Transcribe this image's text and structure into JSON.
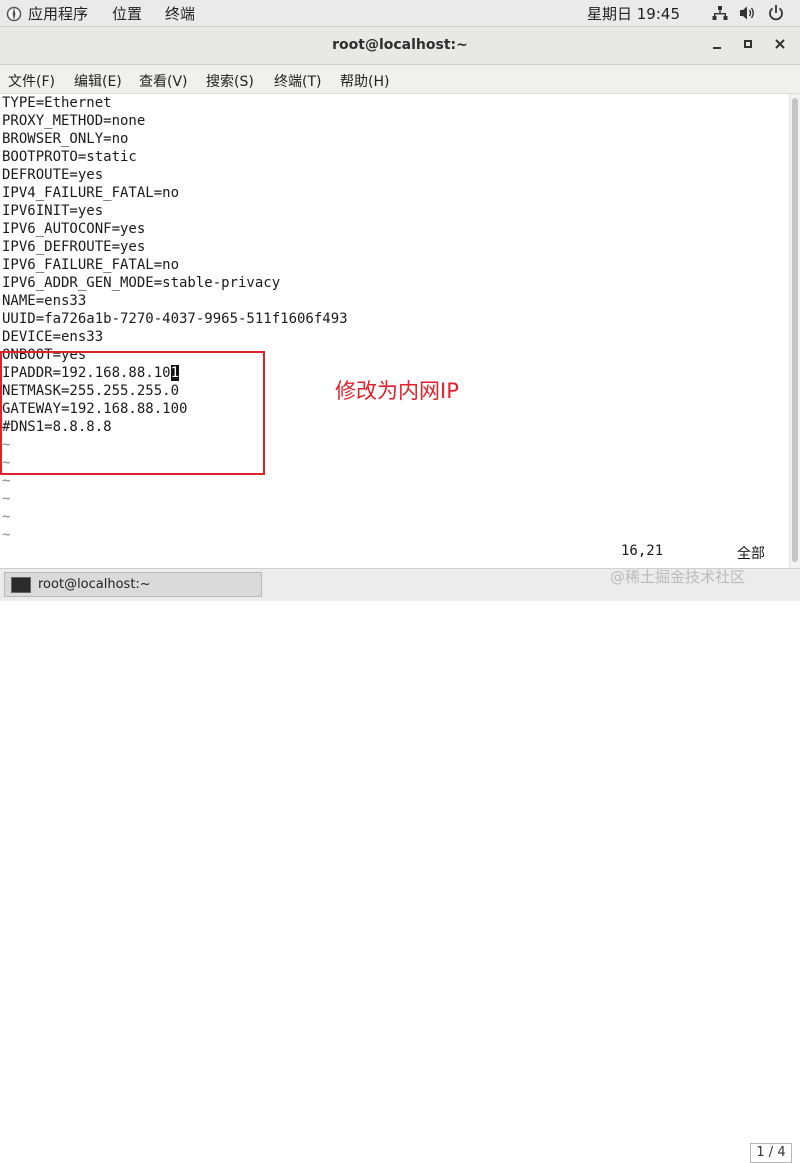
{
  "topbar": {
    "applications": "应用程序",
    "places": "位置",
    "terminal": "终端",
    "clock": "星期日 19:45",
    "icons": [
      "network-icon",
      "volume-icon",
      "power-icon"
    ]
  },
  "window": {
    "title": "root@localhost:~",
    "buttons": [
      "minimize",
      "maximize",
      "close"
    ]
  },
  "menu": {
    "file": "文件(F)",
    "edit": "编辑(E)",
    "view": "查看(V)",
    "search": "搜索(S)",
    "terminal": "终端(T)",
    "help": "帮助(H)"
  },
  "lines": [
    "TYPE=Ethernet",
    "PROXY_METHOD=none",
    "BROWSER_ONLY=no",
    "BOOTPROTO=static",
    "DEFROUTE=yes",
    "IPV4_FAILURE_FATAL=no",
    "IPV6INIT=yes",
    "IPV6_AUTOCONF=yes",
    "IPV6_DEFROUTE=yes",
    "IPV6_FAILURE_FATAL=no",
    "IPV6_ADDR_GEN_MODE=stable-privacy",
    "NAME=ens33",
    "UUID=fa726a1b-7270-4037-9965-511f1606f493",
    "DEVICE=ens33",
    "ONBOOT=yes",
    "IPADDR=192.168.88.10",
    "NETMASK=255.255.255.0",
    "GATEWAY=192.168.88.100",
    "#DNS1=8.8.8.8"
  ],
  "cursor_char": "1",
  "tilde": "~",
  "status": {
    "position": "16,21",
    "scope": "全部"
  },
  "annotation": "修改为内网IP",
  "taskbar": {
    "task_label": "root@localhost:~",
    "pager": "1 / 4"
  },
  "watermark": "@稀土掘金技术社区",
  "colors": {
    "annotation": "#e0202a"
  }
}
